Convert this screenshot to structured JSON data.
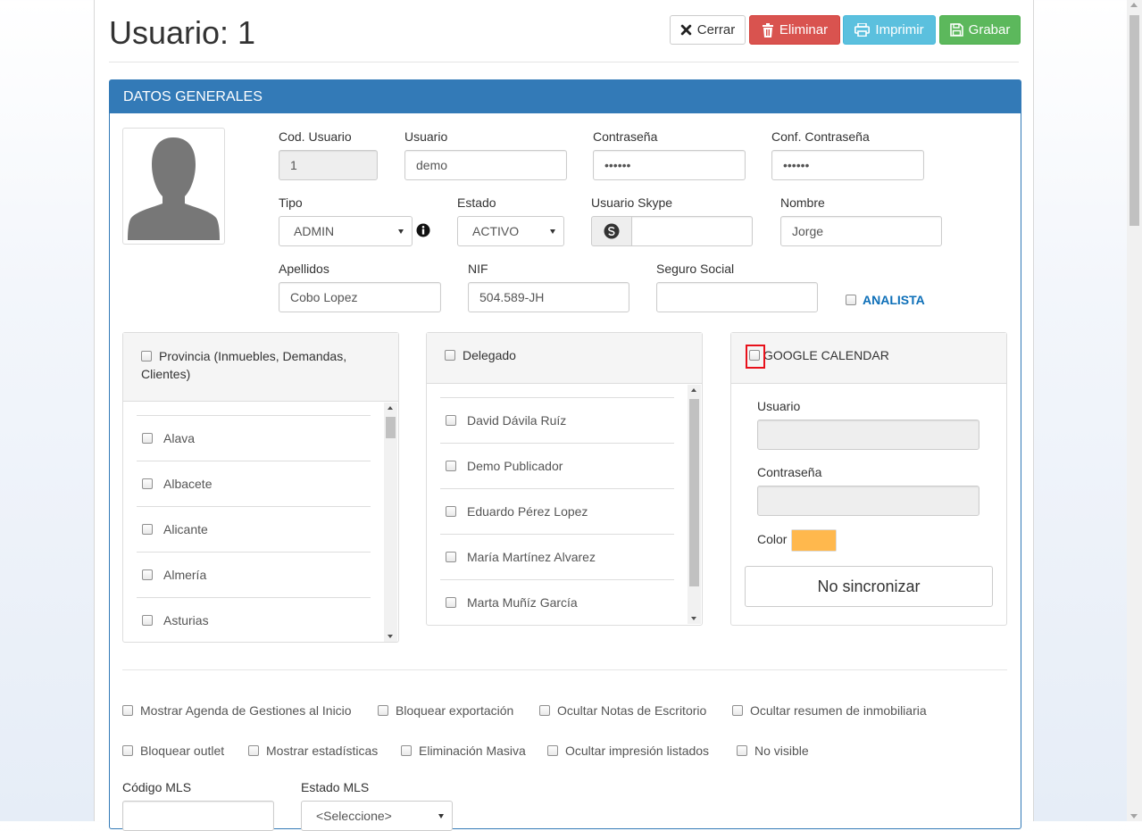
{
  "header": {
    "title": "Usuario: 1",
    "buttons": {
      "cerrar": "Cerrar",
      "eliminar": "Eliminar",
      "imprimir": "Imprimir",
      "grabar": "Grabar"
    }
  },
  "panel": {
    "heading": "DATOS GENERALES",
    "fields": {
      "cod_usuario": {
        "label": "Cod. Usuario",
        "value": "1"
      },
      "usuario": {
        "label": "Usuario",
        "value": "demo"
      },
      "contrasena": {
        "label": "Contraseña",
        "value": "••••••"
      },
      "conf_contrasena": {
        "label": "Conf. Contraseña",
        "value": "••••••"
      },
      "tipo": {
        "label": "Tipo",
        "value": "ADMIN"
      },
      "estado": {
        "label": "Estado",
        "value": "ACTIVO"
      },
      "usuario_skype": {
        "label": "Usuario Skype",
        "value": ""
      },
      "nombre": {
        "label": "Nombre",
        "value": "Jorge"
      },
      "apellidos": {
        "label": "Apellidos",
        "value": "Cobo Lopez"
      },
      "nif": {
        "label": "NIF",
        "value": "504.589-JH"
      },
      "seguro_social": {
        "label": "Seguro Social",
        "value": ""
      },
      "analista": {
        "label": "ANALISTA"
      }
    },
    "provincia": {
      "title": "Provincia (Inmuebles, Demandas, Clientes)",
      "items": [
        "Alava",
        "Albacete",
        "Alicante",
        "Almería",
        "Asturias"
      ]
    },
    "delegado": {
      "title": "Delegado",
      "items": [
        "David Dávila Ruíz",
        "Demo Publicador",
        "Eduardo Pérez Lopez",
        "María Martínez Alvarez",
        "Marta Muñíz García"
      ]
    },
    "google": {
      "title": "GOOGLE CALENDAR",
      "usuario_label": "Usuario",
      "contrasena_label": "Contraseña",
      "color_label": "Color",
      "color_value": "#ffb84d",
      "sync_button": "No sincronizar"
    },
    "options_row1": [
      "Mostrar Agenda de Gestiones al Inicio",
      "Bloquear exportación",
      "Ocultar Notas de Escritorio",
      "Ocultar resumen de inmobiliaria"
    ],
    "options_row2": [
      "Bloquear outlet",
      "Mostrar estadísticas",
      "Eliminación Masiva",
      "Ocultar impresión listados",
      "No visible"
    ],
    "mls": {
      "codigo_label": "Código MLS",
      "estado_label": "Estado MLS",
      "estado_value": "<Seleccione>"
    }
  }
}
